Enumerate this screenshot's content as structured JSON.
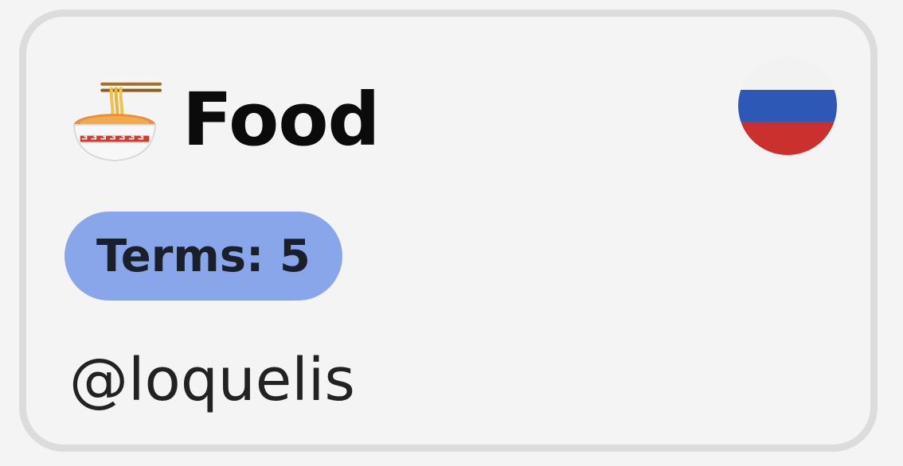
{
  "card": {
    "title": "Food",
    "title_icon": "ramen-bowl-icon",
    "language_flag": "russia-flag-icon",
    "terms_badge": "Terms: 5",
    "author": "@loquelis"
  },
  "colors": {
    "background": "#f4f4f4",
    "card_border": "#dcdcdc",
    "badge_bg": "#8aa6ea",
    "flag_white": "#f2f2f2",
    "flag_blue": "#2d58b6",
    "flag_red": "#c9302e"
  }
}
